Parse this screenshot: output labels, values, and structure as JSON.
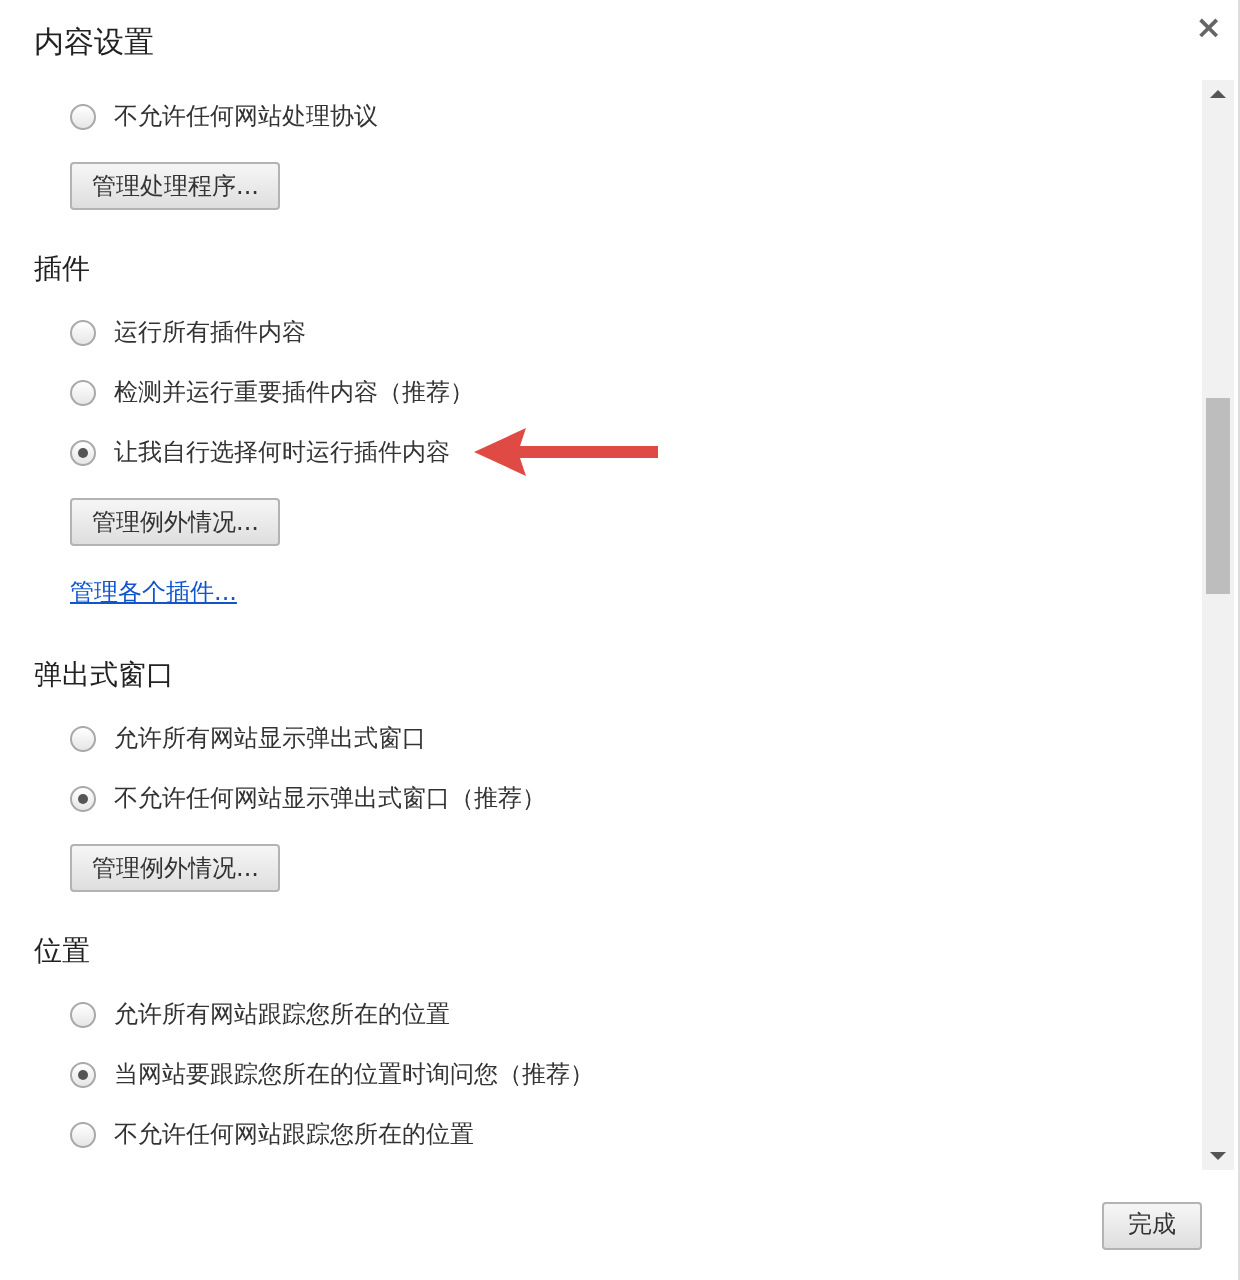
{
  "dialog": {
    "title": "内容设置",
    "close": "×"
  },
  "sections": [
    {
      "items": [
        {
          "kind": "radio",
          "label": "不允许任何网站处理协议",
          "selected": false
        },
        {
          "kind": "button",
          "label": "管理处理程序..."
        }
      ]
    },
    {
      "heading": "插件",
      "items": [
        {
          "kind": "radio",
          "label": "运行所有插件内容",
          "selected": false
        },
        {
          "kind": "radio",
          "label": "检测并运行重要插件内容（推荐）",
          "selected": false
        },
        {
          "kind": "radio",
          "label": "让我自行选择何时运行插件内容",
          "selected": true,
          "annotated": true
        },
        {
          "kind": "button",
          "label": "管理例外情况..."
        },
        {
          "kind": "link",
          "label": "管理各个插件..."
        }
      ]
    },
    {
      "heading": "弹出式窗口",
      "items": [
        {
          "kind": "radio",
          "label": "允许所有网站显示弹出式窗口",
          "selected": false
        },
        {
          "kind": "radio",
          "label": "不允许任何网站显示弹出式窗口（推荐）",
          "selected": true
        },
        {
          "kind": "button",
          "label": "管理例外情况..."
        }
      ]
    },
    {
      "heading": "位置",
      "items": [
        {
          "kind": "radio",
          "label": "允许所有网站跟踪您所在的位置",
          "selected": false
        },
        {
          "kind": "radio",
          "label": "当网站要跟踪您所在的位置时询问您（推荐）",
          "selected": true
        },
        {
          "kind": "radio",
          "label": "不允许任何网站跟踪您所在的位置",
          "selected": false
        }
      ]
    }
  ],
  "footer": {
    "done_button": "完成"
  }
}
